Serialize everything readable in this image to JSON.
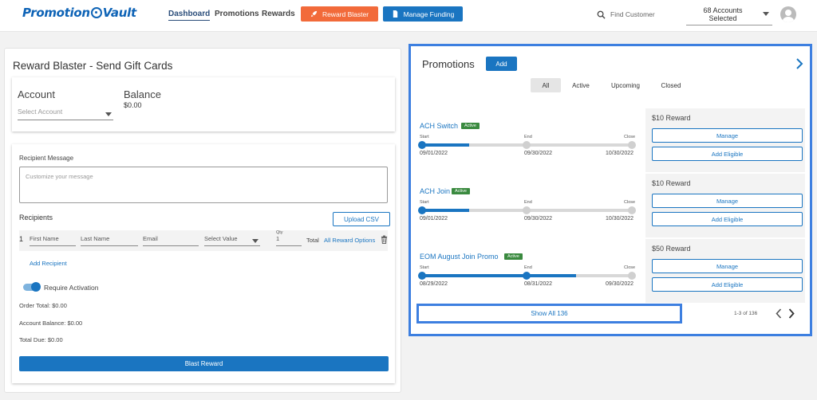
{
  "header": {
    "logo_left": "Promotion",
    "logo_right": "Vault",
    "nav": [
      "Dashboard",
      "Promotions",
      "Rewards"
    ],
    "reward_blaster_label": "Reward Blaster",
    "manage_funding_label": "Manage Funding",
    "search_placeholder": "Find Customer",
    "accounts_line1": "68 Accounts",
    "accounts_line2": "Selected"
  },
  "left": {
    "title": "Reward Blaster - Send Gift Cards",
    "account_label": "Account",
    "account_placeholder": "Select Account",
    "balance_label": "Balance",
    "balance_value": "$0.00",
    "recipient_message_label": "Recipient Message",
    "message_placeholder": "Customize your message",
    "recipients_label": "Recipients",
    "upload_csv_label": "Upload CSV",
    "row": {
      "number": "1",
      "first_name": "First Name",
      "last_name": "Last Name",
      "email": "Email",
      "select_value": "Select Value",
      "qty_label": "Qty",
      "qty_value": "1",
      "total_label": "Total",
      "all_reward_options": "All Reward Options"
    },
    "add_recipient_label": "Add Recipient",
    "require_activation_label": "Require Activation",
    "order_total": "Order Total: $0.00",
    "account_balance": "Account Balance: $0.00",
    "total_due": "Total Due: $0.00",
    "blast_reward_label": "Blast Reward"
  },
  "promotions": {
    "title": "Promotions",
    "add_label": "Add",
    "filters": [
      "All",
      "Active",
      "Upcoming",
      "Closed"
    ],
    "timeline_labels": {
      "start": "Start",
      "end": "End",
      "close": "Close"
    },
    "items": [
      {
        "name": "ACH Switch",
        "status": "Active",
        "start": "09/01/2022",
        "end": "09/30/2022",
        "close": "10/30/2022",
        "progress": 0.23,
        "reward": "$10 Reward",
        "manage": "Manage",
        "add_eligible": "Add Eligible"
      },
      {
        "name": "ACH Join",
        "status": "Active",
        "start": "09/01/2022",
        "end": "09/30/2022",
        "close": "10/30/2022",
        "progress": 0.23,
        "reward": "$10 Reward",
        "manage": "Manage",
        "add_eligible": "Add Eligible"
      },
      {
        "name": "EOM August Join Promo",
        "status": "Active",
        "start": "08/29/2022",
        "end": "08/31/2022",
        "close": "09/30/2022",
        "progress": 0.73,
        "reward": "$50 Reward",
        "manage": "Manage",
        "add_eligible": "Add Eligible"
      }
    ],
    "show_all_label": "Show All 136",
    "pager_text": "1-3 of 136"
  },
  "colors": {
    "primary": "#1a75c1",
    "orange": "#f26a3a",
    "active_badge": "#3a8a3f",
    "highlight": "#3d7fe0"
  },
  "icons": [
    "search-icon",
    "rocket-icon",
    "document-icon",
    "chevron-down-icon",
    "avatar-icon",
    "trash-icon",
    "chevron-right-icon",
    "chevron-left-icon"
  ]
}
